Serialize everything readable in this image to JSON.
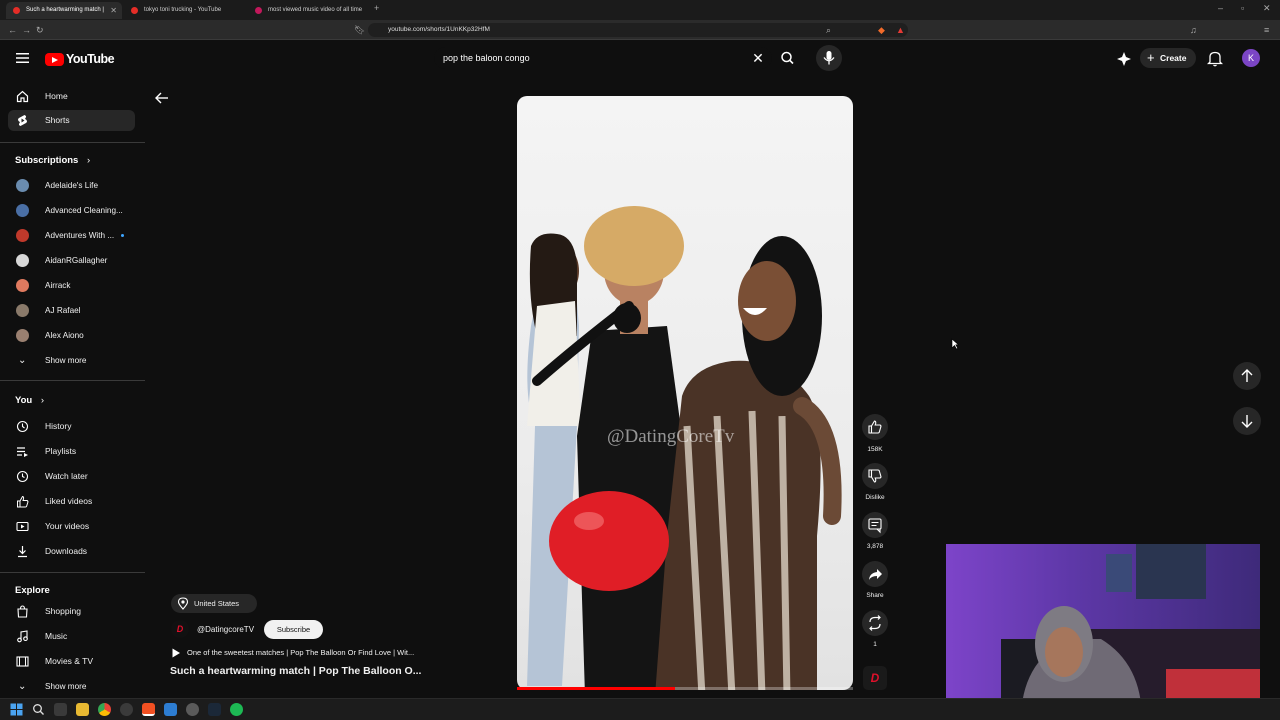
{
  "browser": {
    "tabs": [
      {
        "label": "Such a heartwarming match |",
        "active": true
      },
      {
        "label": "tokyo toni trucking - YouTube",
        "active": false
      },
      {
        "label": "most viewed music video of all time",
        "active": false
      }
    ],
    "url": "youtube.com/shorts/1UnKKp32HfM"
  },
  "header": {
    "logo_text": "YouTube",
    "search_value": "pop the baloon congo",
    "create_label": "Create",
    "avatar_letter": "K"
  },
  "sidebar": {
    "main": [
      {
        "label": "Home",
        "icon": "home-icon",
        "selected": false
      },
      {
        "label": "Shorts",
        "icon": "shorts-icon",
        "selected": true
      }
    ],
    "subscriptions_heading": "Subscriptions",
    "subscriptions": [
      {
        "label": "Adelaide's Life",
        "color": "#6a8caf"
      },
      {
        "label": "Advanced Cleaning...",
        "color": "#4a6fa5"
      },
      {
        "label": "Adventures With ...",
        "color": "#c0392b",
        "live_dot": true
      },
      {
        "label": "AidanRGallagher",
        "color": "#d8d8d8"
      },
      {
        "label": "Airrack",
        "color": "#e07a5f"
      },
      {
        "label": "AJ Rafael",
        "color": "#8a7a6a"
      },
      {
        "label": "Alex Aiono",
        "color": "#9a8070"
      }
    ],
    "subs_show_more": "Show more",
    "you_heading": "You",
    "you": [
      {
        "label": "History",
        "icon": "history-icon"
      },
      {
        "label": "Playlists",
        "icon": "playlists-icon"
      },
      {
        "label": "Watch later",
        "icon": "watch-later-icon"
      },
      {
        "label": "Liked videos",
        "icon": "liked-videos-icon"
      },
      {
        "label": "Your videos",
        "icon": "your-videos-icon"
      },
      {
        "label": "Downloads",
        "icon": "downloads-icon"
      }
    ],
    "explore_heading": "Explore",
    "explore": [
      {
        "label": "Shopping",
        "icon": "shopping-icon"
      },
      {
        "label": "Music",
        "icon": "music-icon"
      },
      {
        "label": "Movies & TV",
        "icon": "movies-icon"
      }
    ],
    "explore_show_more": "Show more"
  },
  "short": {
    "watermark": "@DatingCoreTv",
    "progress": 0.47,
    "location": "United States",
    "channel_handle": "@DatingcoreTV",
    "subscribe_label": "Subscribe",
    "description": "One of the sweetest matches | Pop The Balloon Or Find Love | Wit...",
    "title": "Such a heartwarming match | Pop The Balloon O...",
    "actions": {
      "likes": "158K",
      "dislike": "Dislike",
      "comments": "3,878",
      "share": "Share",
      "remix": "1"
    },
    "badge_letter": "D"
  },
  "colors": {
    "accent_red": "#ff0000",
    "background": "#0f0f0f",
    "chip": "#272727"
  }
}
